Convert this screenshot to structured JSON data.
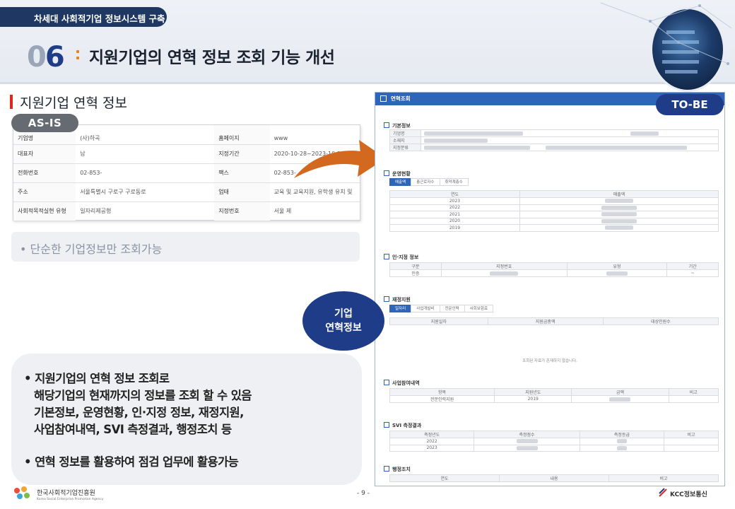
{
  "header": {
    "project_tab": "차세대 사회적기업 정보시스템 구축",
    "num_zero": "0",
    "num_six": "6",
    "title": "지원기업의 연혁 정보 조회 기능 개선"
  },
  "section_title": "지원기업 연혁 정보",
  "as_is": {
    "tag": "AS-IS",
    "rows": [
      [
        "기업명",
        "(사)하곡",
        "홈페이지",
        "www"
      ],
      [
        "대표자",
        "남",
        "지정기간",
        "2020-10-28~2023-10-27"
      ],
      [
        "전화번호",
        "02-853-",
        "팩스",
        "02-853-"
      ],
      [
        "주소",
        "서울특별시 구로구 구로동로",
        "업태",
        "교육 및 교육지원, 유학생 유치 및"
      ],
      [
        "사회적목적실현 유형",
        "일자리제공형",
        "지정번호",
        "서울 제"
      ]
    ],
    "summary": "• 단순한 기업정보만 조회가능"
  },
  "to_be": {
    "tag": "TO-BE",
    "window_title": "연혁조회",
    "sections": {
      "basic": "기본정보",
      "operation": "운영현황",
      "cert": "인·지정 정보",
      "finance": "재정지원",
      "project": "사업참여내역",
      "svi": "SVI 측정결과",
      "admin": "행정조치"
    },
    "basic_rows": [
      "기업명",
      "소재지",
      "지정분류"
    ],
    "operation_tabs": [
      "매출액",
      "총근로자수",
      "취약계층수"
    ],
    "operation_headers": [
      "연도",
      "매출액"
    ],
    "operation_years": [
      "2023",
      "2022",
      "2021",
      "2020",
      "2019"
    ],
    "cert_headers": [
      "구분",
      "지정번호",
      "유형",
      "기간"
    ],
    "cert_row": [
      "인증",
      "",
      "",
      "~"
    ],
    "finance_tabs": [
      "일자리",
      "사업개발비",
      "전문인력",
      "사회보험료"
    ],
    "finance_headers": [
      "지원일자",
      "지원금총액",
      "대상인원수"
    ],
    "finance_empty": "조회된 자료가 존재하지 않습니다.",
    "project_headers": [
      "항목",
      "지원년도",
      "금액",
      "비고"
    ],
    "project_row": [
      "전문인력지원",
      "2019",
      "",
      ""
    ],
    "svi_headers": [
      "측정년도",
      "측정점수",
      "측정등급",
      "비고"
    ],
    "svi_years": [
      "2022",
      "2023"
    ],
    "admin_headers": [
      "연도",
      "내용",
      "비고"
    ]
  },
  "bubble": {
    "line1": "기업",
    "line2": "연혁정보"
  },
  "description": {
    "line1": "• 지원기업의 연혁 정보 조회로",
    "line2": "해당기업의 현재까지의 정보를 조회 할 수 있음",
    "line3": "기본정보, 운영현황, 인·지정 정보, 재정지원,",
    "line4": "사업참여내역, SVI 측정결과, 행정조치 등",
    "line5": "• 연혁 정보를 활용하여 점검 업무에 활용가능"
  },
  "footer": {
    "org_name": "한국사회적기업진흥원",
    "org_name_en": "Korea Social Enterprise Promotion Agency",
    "page_number": "- 9 -",
    "company": "KCC정보통신"
  },
  "colors": {
    "navy": "#1f3c88",
    "accent_red": "#e0271e",
    "arrow_orange": "#d2691e",
    "blue_header": "#2f65b9"
  }
}
